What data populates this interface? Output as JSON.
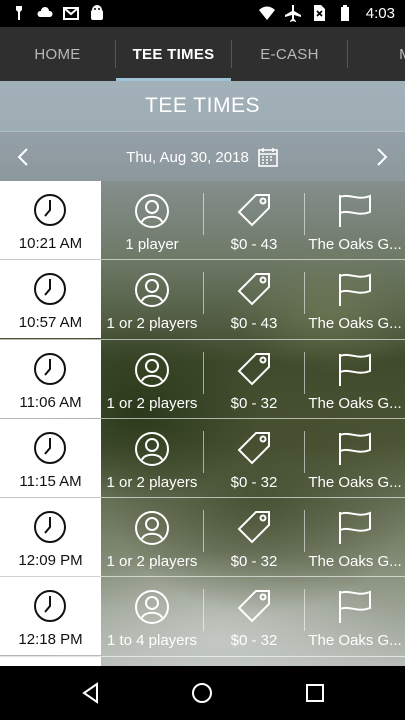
{
  "status_bar": {
    "time": "4:03",
    "left_icons": [
      "notification-icon",
      "cloud-icon",
      "gmail-icon",
      "android-icon"
    ],
    "right_icons": [
      "wifi-icon",
      "airplane-mode-icon",
      "no-sim-icon",
      "battery-icon"
    ]
  },
  "tabs": [
    {
      "label": "HOME",
      "active": false
    },
    {
      "label": "TEE TIMES",
      "active": true
    },
    {
      "label": "E-CASH",
      "active": false
    },
    {
      "label": "M",
      "active": false
    }
  ],
  "header": {
    "title": "TEE TIMES"
  },
  "date_bar": {
    "date": "Thu, Aug 30, 2018",
    "prev_icon": "chevron-left-icon",
    "next_icon": "chevron-right-icon",
    "calendar_icon": "calendar-icon"
  },
  "tee_times": [
    {
      "time": "10:21 AM",
      "players": "1 player",
      "price": "$0 - 43",
      "course": "The Oaks G..."
    },
    {
      "time": "10:57 AM",
      "players": "1 or 2 players",
      "price": "$0 - 43",
      "course": "The Oaks G..."
    },
    {
      "time": "11:06 AM",
      "players": "1 or 2 players",
      "price": "$0 - 32",
      "course": "The Oaks G..."
    },
    {
      "time": "11:15 AM",
      "players": "1 or 2 players",
      "price": "$0 - 32",
      "course": "The Oaks G..."
    },
    {
      "time": "12:09 PM",
      "players": "1 or 2 players",
      "price": "$0 - 32",
      "course": "The Oaks G..."
    },
    {
      "time": "12:18 PM",
      "players": "1 to 4 players",
      "price": "$0 - 32",
      "course": "The Oaks G..."
    }
  ],
  "nav_bar": {
    "icons": [
      "back-icon",
      "home-icon",
      "recents-icon"
    ]
  }
}
